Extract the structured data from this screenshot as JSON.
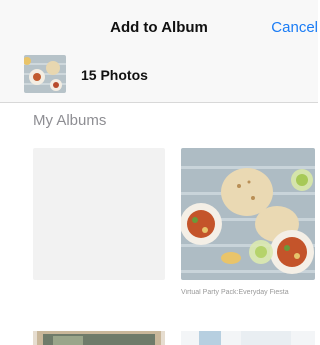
{
  "nav": {
    "title": "Add to Album",
    "cancel_label": "Cancel"
  },
  "selection": {
    "count_label": "15 Photos"
  },
  "section": {
    "title": "My Albums"
  },
  "albums": [
    {
      "caption": ""
    },
    {
      "caption": "Virtual Party Pack:Everyday Fiesta"
    }
  ],
  "colors": {
    "accent": "#1a7cf5",
    "navbar_bg": "#f8f8f8",
    "secondary_text": "#8e8e93"
  }
}
